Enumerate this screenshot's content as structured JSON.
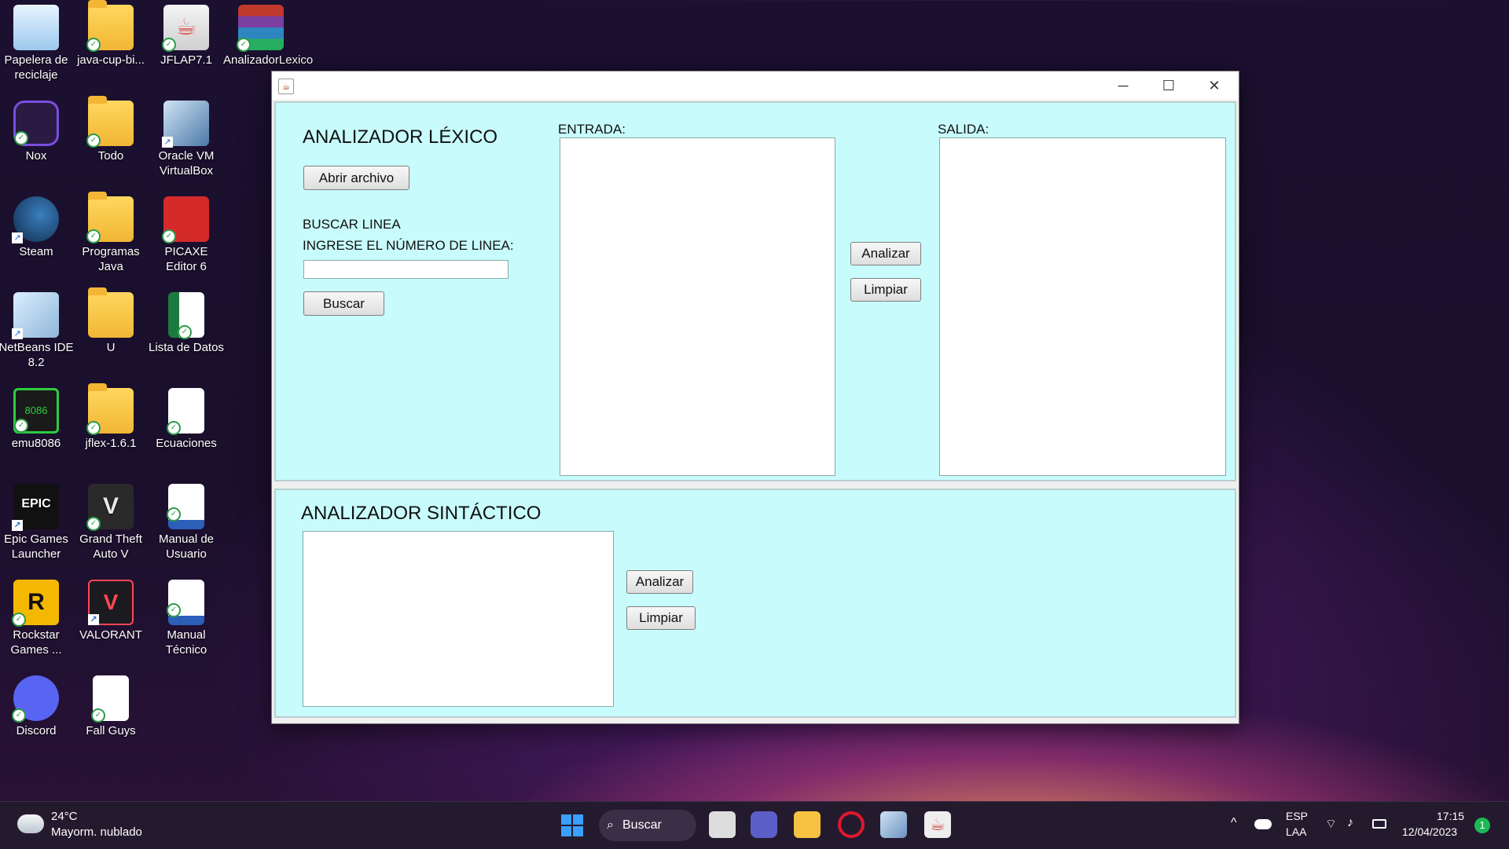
{
  "desktop": {
    "icons": [
      {
        "label": "Papelera de reciclaje",
        "icon": "recycle-bin-icon"
      },
      {
        "label": "java-cup-bi...",
        "icon": "folder-icon"
      },
      {
        "label": "JFLAP7.1",
        "icon": "java-icon"
      },
      {
        "label": "AnalizadorLexico",
        "icon": "winrar-icon"
      },
      {
        "label": "Nox",
        "icon": "nox-icon"
      },
      {
        "label": "Todo",
        "icon": "folder-icon"
      },
      {
        "label": "Oracle VM VirtualBox",
        "icon": "virtualbox-icon"
      },
      {
        "label": "Steam",
        "icon": "steam-icon"
      },
      {
        "label": "Programas Java",
        "icon": "folder-icon"
      },
      {
        "label": "PICAXE Editor 6",
        "icon": "picaxe-icon"
      },
      {
        "label": "NetBeans IDE 8.2",
        "icon": "netbeans-icon"
      },
      {
        "label": "U",
        "icon": "folder-icon"
      },
      {
        "label": "Lista de Datos",
        "icon": "excel-icon"
      },
      {
        "label": "emu8086",
        "icon": "emu8086-icon"
      },
      {
        "label": "jflex-1.6.1",
        "icon": "folder-icon"
      },
      {
        "label": "Ecuaciones",
        "icon": "document-icon"
      },
      {
        "label": "Epic Games Launcher",
        "icon": "epic-games-icon"
      },
      {
        "label": "Grand Theft Auto V",
        "icon": "gta-icon"
      },
      {
        "label": "Manual de Usuario",
        "icon": "word-icon"
      },
      {
        "label": "Rockstar Games ...",
        "icon": "rockstar-icon"
      },
      {
        "label": "VALORANT",
        "icon": "valorant-icon"
      },
      {
        "label": "Manual Técnico",
        "icon": "word-icon"
      },
      {
        "label": "Discord",
        "icon": "discord-icon"
      },
      {
        "label": "Fall Guys",
        "icon": "document-icon"
      }
    ]
  },
  "window": {
    "controls": {
      "minimize": "─",
      "maximize": "☐",
      "close": "✕"
    },
    "lexico": {
      "title": "ANALIZADOR LÉXICO",
      "open_button": "Abrir archivo",
      "search_heading": "BUSCAR LINEA",
      "line_prompt": "INGRESE EL NÚMERO DE LINEA:",
      "line_value": "",
      "search_button": "Buscar",
      "entrada_label": "ENTRADA:",
      "salida_label": "SALIDA:",
      "analyze_button": "Analizar",
      "clear_button": "Limpiar"
    },
    "sintactico": {
      "title": "ANALIZADOR SINTÁCTICO",
      "analyze_button": "Analizar",
      "clear_button": "Limpiar"
    }
  },
  "taskbar": {
    "weather_temp": "24°C",
    "weather_desc": "Mayorm. nublado",
    "search_label": "Buscar",
    "lang_top": "ESP",
    "lang_bottom": "LAA",
    "time": "17:15",
    "date": "12/04/2023",
    "notification_count": "1"
  }
}
